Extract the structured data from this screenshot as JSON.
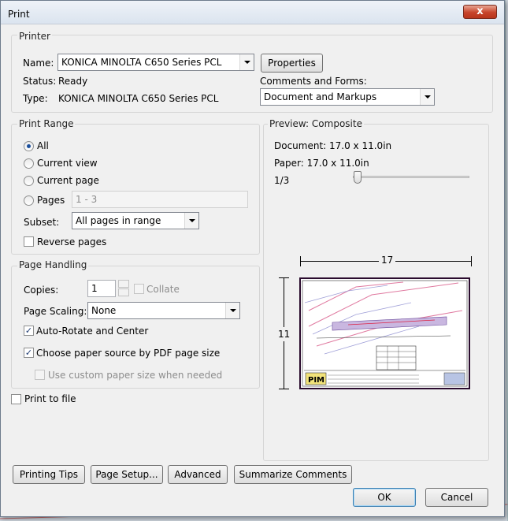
{
  "window": {
    "title": "Print",
    "close": "x"
  },
  "printer": {
    "group": "Printer",
    "name_label": "Name:",
    "name_value": "KONICA MINOLTA C650 Series PCL",
    "properties": "Properties",
    "status_label": "Status:",
    "status_value": "Ready",
    "type_label": "Type:",
    "type_value": "KONICA MINOLTA C650 Series PCL",
    "comments_label": "Comments and Forms:",
    "comments_value": "Document and Markups"
  },
  "range": {
    "group": "Print Range",
    "all": "All",
    "current_view": "Current view",
    "current_page": "Current page",
    "pages": "Pages",
    "pages_value": "1 - 3",
    "subset_label": "Subset:",
    "subset_value": "All pages in range",
    "reverse": "Reverse pages"
  },
  "handling": {
    "group": "Page Handling",
    "copies_label": "Copies:",
    "copies_value": "1",
    "collate": "Collate",
    "scaling_label": "Page Scaling:",
    "scaling_value": "None",
    "auto_rotate": "Auto-Rotate and Center",
    "paper_source": "Choose paper source by PDF page size",
    "custom_paper": "Use custom paper size when needed"
  },
  "print_to_file": "Print to file",
  "preview": {
    "group": "Preview: Composite",
    "document": "Document: 17.0 x 11.0in",
    "paper": "Paper: 17.0 x 11.0in",
    "page": "1/3",
    "width": "17",
    "height": "11",
    "logo": "PIM"
  },
  "buttons": {
    "tips": "Printing Tips",
    "setup": "Page Setup...",
    "advanced": "Advanced",
    "summarize": "Summarize Comments",
    "ok": "OK",
    "cancel": "Cancel"
  },
  "colors": {
    "accent": "#1b4f9c",
    "close": "#c7442b"
  }
}
